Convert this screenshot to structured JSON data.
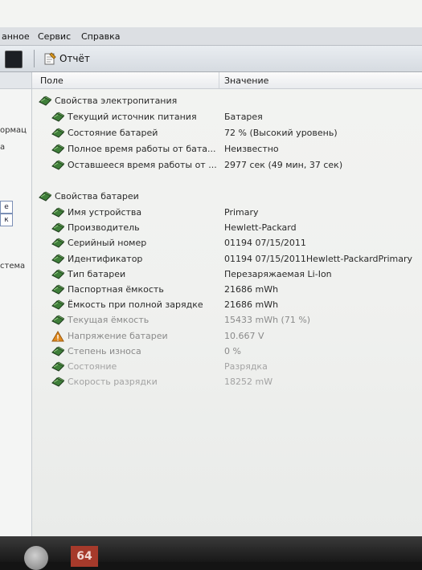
{
  "menu": {
    "items": [
      "анное",
      "Сервис",
      "Справка"
    ]
  },
  "toolbar": {
    "report_label": "Отчёт"
  },
  "left_pane": {
    "fragments": [
      "ормац",
      "а",
      "е",
      "к",
      "стема"
    ]
  },
  "columns": {
    "field": "Поле",
    "value": "Значение"
  },
  "power_group": {
    "title": "Свойства электропитания",
    "rows": [
      {
        "label": "Текущий источник питания",
        "value": "Батарея"
      },
      {
        "label": "Состояние батарей",
        "value": "72 % (Высокий уровень)"
      },
      {
        "label": "Полное время работы от бата...",
        "value": "Неизвестно"
      },
      {
        "label": "Оставшееся время работы от ...",
        "value": "2977 сек (49 мин, 37 сек)"
      }
    ]
  },
  "battery_group": {
    "title": "Свойства батареи",
    "rows": [
      {
        "label": "Имя устройства",
        "value": "Primary"
      },
      {
        "label": "Производитель",
        "value": "Hewlett-Packard"
      },
      {
        "label": "Серийный номер",
        "value": "01194 07/15/2011"
      },
      {
        "label": "Идентификатор",
        "value": "01194 07/15/2011Hewlett-PackardPrimary"
      },
      {
        "label": "Тип батареи",
        "value": "Перезаряжаемая Li-Ion"
      },
      {
        "label": "Паспортная ёмкость",
        "value": "21686 mWh"
      },
      {
        "label": "Ёмкость при полной зарядке",
        "value": "21686 mWh"
      },
      {
        "label": "Текущая ёмкость",
        "value": "15433 mWh  (71 %)"
      },
      {
        "label": "Напряжение батареи",
        "value": "10.667 V"
      },
      {
        "label": "Степень износа",
        "value": "0 %"
      },
      {
        "label": "Состояние",
        "value": "Разрядка"
      },
      {
        "label": "Скорость разрядки",
        "value": "18252 mW"
      }
    ]
  },
  "taskbar": {
    "badge": "64"
  },
  "colors": {
    "icon_green": "#3f7f3a",
    "icon_dark": "#1e3b1c",
    "warning_orange": "#e08a1f"
  }
}
